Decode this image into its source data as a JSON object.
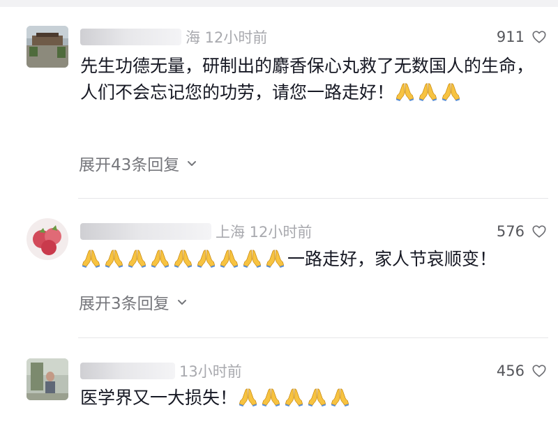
{
  "comments": [
    {
      "username": "",
      "location_time": "海 12小时前",
      "likes": "911",
      "text": "先生功德无量，研制出的麝香保心丸救了无数国人的生命，人们不会忘记您的功劳，请您一路走好！",
      "trailing_emoji_count": 3,
      "expand_label": "展开43条回复",
      "avatar_icon": "photo-avatar-icon"
    },
    {
      "username": "",
      "location_time": "上海 12小时前",
      "likes": "576",
      "leading_emoji_count": 9,
      "text": "一路走好，家人节哀顺变！",
      "expand_label": "展开3条回复",
      "avatar_icon": "fruit-avatar-icon"
    },
    {
      "username": "",
      "location_time": "13小时前",
      "likes": "456",
      "text": "医学界又一大损失！",
      "trailing_emoji_count": 5,
      "avatar_icon": "photo-avatar-icon"
    }
  ],
  "icons": {
    "like": "heart-outline-icon",
    "expand": "chevron-down-icon",
    "emoji": "folded-hands-emoji"
  },
  "colors": {
    "text": "#161823",
    "meta": "#a8a9ae",
    "secondary": "#75767b",
    "emoji_skin": "#f7c341"
  }
}
